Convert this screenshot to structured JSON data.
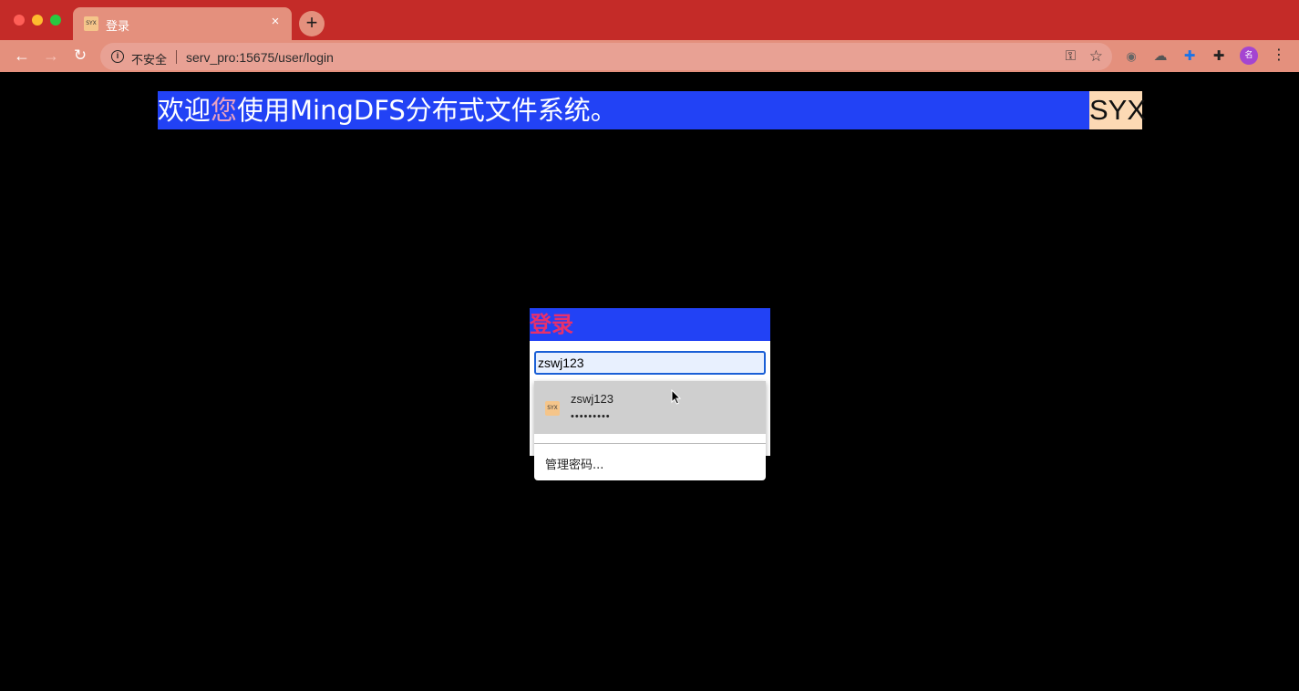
{
  "browser": {
    "tab": {
      "favicon_text": "SYX",
      "title": "登录",
      "close": "×"
    },
    "new_tab": "+",
    "nav": {
      "back": "←",
      "forward": "→",
      "reload": "↻"
    },
    "omnibox": {
      "security_label": "不安全",
      "url": "serv_pro:15675/user/login"
    },
    "avatar_text": "名"
  },
  "page": {
    "banner": {
      "prefix": "欢迎",
      "highlight": "您",
      "suffix": "使用MingDFS分布式文件系统。"
    },
    "brand": "SYX",
    "login": {
      "title": "登录",
      "username_value": "zswj123"
    },
    "autofill": {
      "favicon_text": "SYX",
      "username": "zswj123",
      "password_mask": "•••••••••",
      "manage_label": "管理密码..."
    }
  },
  "colors": {
    "tabbar": "#c42b28",
    "toolbar": "#e4907d",
    "banner": "#2242f5",
    "brand": "#fcd9b4",
    "login_title": "#e8306b"
  }
}
